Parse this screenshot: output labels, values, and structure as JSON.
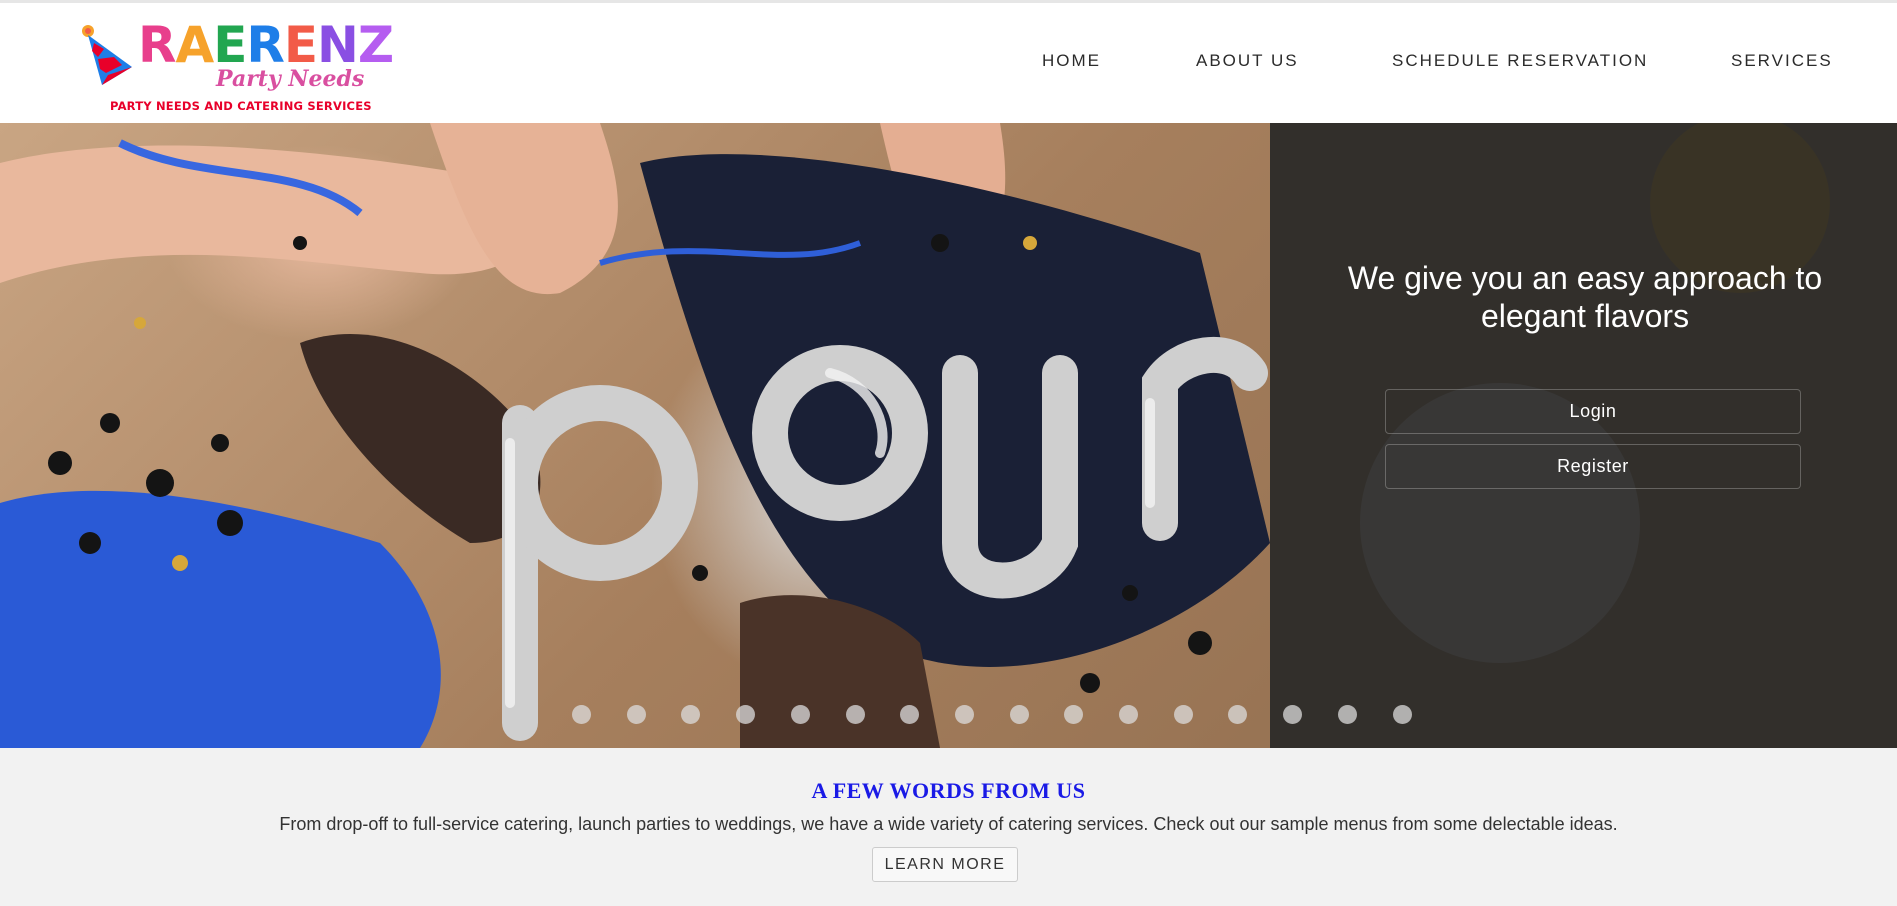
{
  "logo": {
    "brand_letters": [
      "R",
      "A",
      "E",
      "R",
      "E",
      "N",
      "Z"
    ],
    "brand_colors": [
      "#e83f8c",
      "#f6a22b",
      "#22a650",
      "#1e7ee8",
      "#f25b48",
      "#8a4fe3",
      "#b55df0"
    ],
    "subbrand": "Party Needs",
    "tagline": "PARTY NEEDS AND CATERING SERVICES"
  },
  "nav": {
    "items": [
      {
        "label": "HOME"
      },
      {
        "label": "ABOUT US"
      },
      {
        "label": "SCHEDULE RESERVATION"
      },
      {
        "label": "SERVICES"
      }
    ]
  },
  "hero": {
    "headline": "We give you an easy approach to elegant flavors",
    "login_label": "Login",
    "register_label": "Register",
    "slide_count": 16,
    "active_slide": 0
  },
  "intro": {
    "heading": "A FEW WORDS FROM US",
    "text": "From drop-off to full-service catering, launch parties to weddings, we have a wide variety of catering services. Check out our sample menus from some delectable ideas.",
    "button_label": "LEARN MORE"
  },
  "colors": {
    "heading_blue": "#1a1ae6",
    "tagline_red": "#e8002a",
    "overlay": "#1e1e1e"
  }
}
